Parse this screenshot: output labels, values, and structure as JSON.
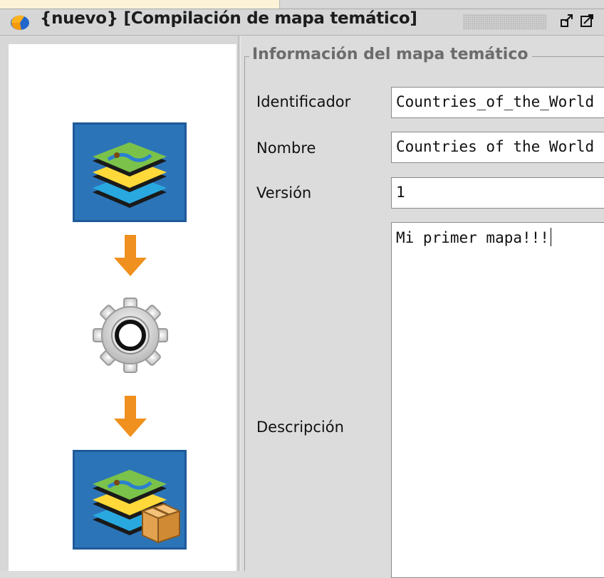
{
  "window": {
    "title": "{nuevo} [Compilación de mapa temático]",
    "icons": [
      "app-logo-icon",
      "restore-icon",
      "maximize-icon"
    ]
  },
  "wizard": {
    "steps": [
      "thematic-map-layers-icon",
      "down-arrow-icon",
      "gear-icon",
      "down-arrow-icon",
      "packaged-map-icon"
    ]
  },
  "form": {
    "group_title": "Información del mapa temático",
    "fields": [
      {
        "label": "Identificador",
        "value": "Countries_of_the_World"
      },
      {
        "label": "Nombre",
        "value": "Countries of the World"
      },
      {
        "label": "Versión",
        "value": "1"
      }
    ],
    "description": {
      "label": "Descripción",
      "value": "Mi primer mapa!!!"
    }
  },
  "colors": {
    "icon_tile": "#1e5a9a",
    "arrow": "#f0901e",
    "title_bar": "#d6d6d6"
  }
}
